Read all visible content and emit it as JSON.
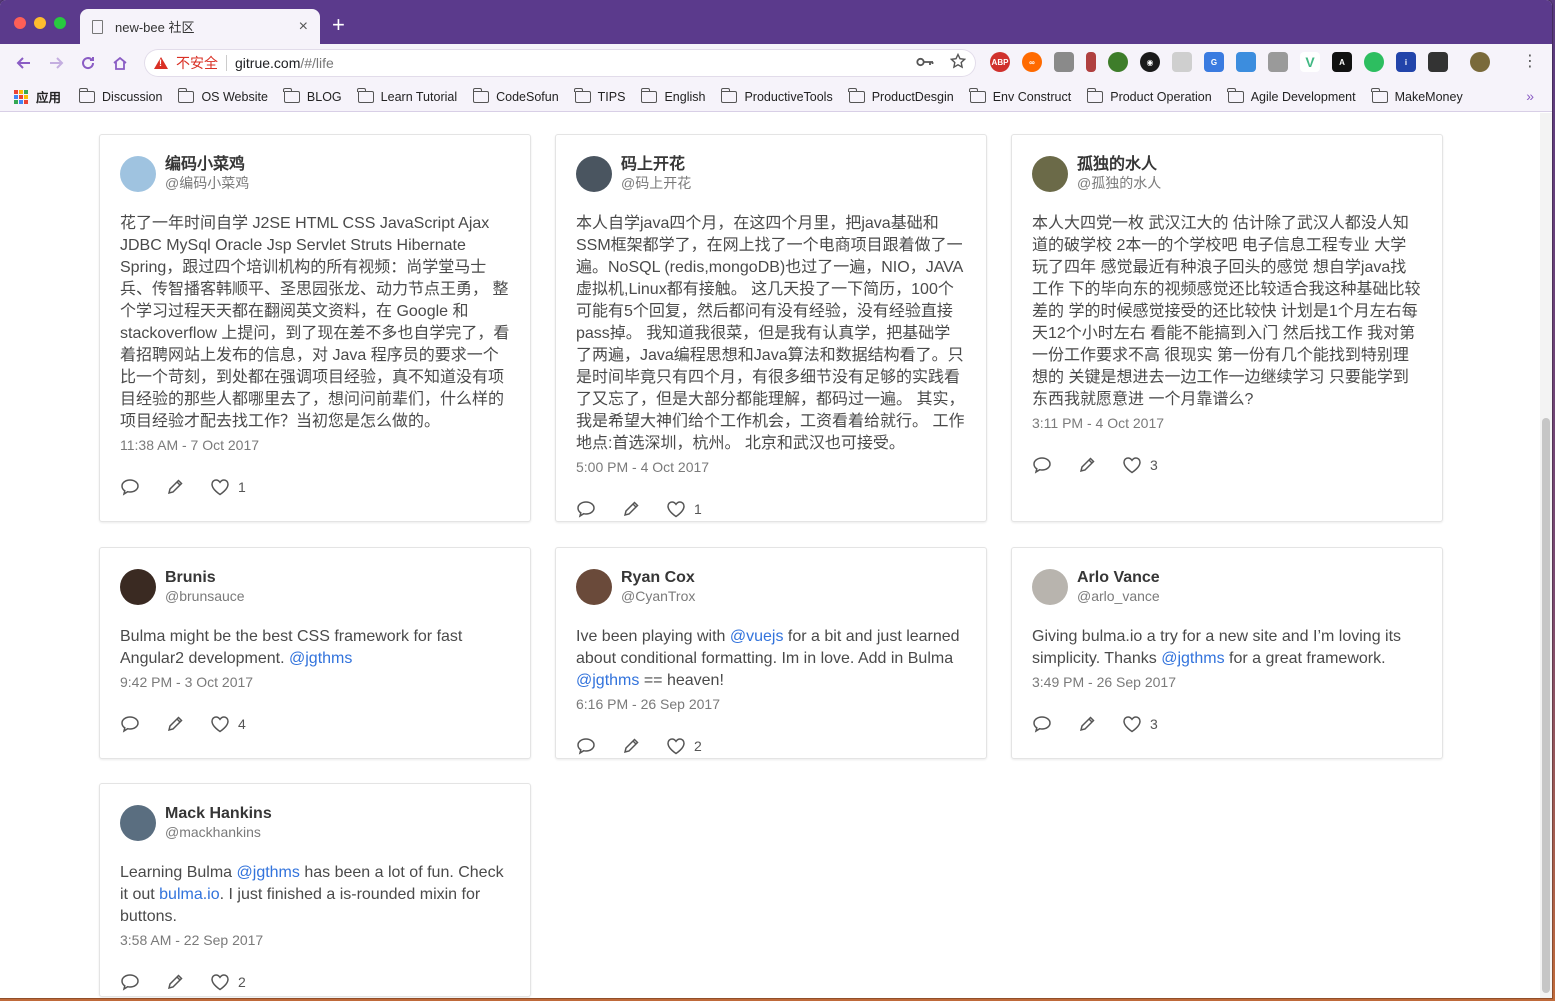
{
  "browser": {
    "tab_title": "new-bee 社区",
    "close_glyph": "×",
    "new_tab_glyph": "+",
    "insecure_label": "不安全",
    "url_host": "gitrue.com",
    "url_path": "/#/life",
    "apps_label": "应用",
    "bookmarks": [
      "Discussion",
      "OS Website",
      "BLOG",
      "Learn Tutorial",
      "CodeSofun",
      "TIPS",
      "English",
      "ProductiveTools",
      "ProductDesgin",
      "Env Construct",
      "Product Operation",
      "Agile Development",
      "MakeMoney"
    ],
    "more_glyph": "»",
    "extensions": [
      "abp-icon",
      "infinity-icon",
      "puzzle-icon",
      "crossed-icon",
      "android-icon",
      "eye-icon",
      "mail-icon",
      "translate-icon",
      "doc-icon",
      "inbox-icon",
      "vue-devtools-icon",
      "antd-icon",
      "evernote-icon",
      "info-icon",
      "code-icon",
      "profile-avatar"
    ]
  },
  "posts": [
    {
      "name": "编码小菜鸡",
      "handle": "@编码小菜鸡",
      "avatar_color": "#9fc3e0",
      "text": "花了一年时间自学 J2SE HTML CSS JavaScript Ajax JDBC MySql Oracle Jsp Servlet Struts Hibernate Spring，跟过四个培训机构的所有视频：尚学堂马士兵、传智播客韩顺平、圣思园张龙、动力节点王勇， 整个学习过程天天都在翻阅英文资料，在 Google 和 stackoverflow 上提问，到了现在差不多也自学完了，看着招聘网站上发布的信息，对 Java 程序员的要求一个比一个苛刻，到处都在强调项目经验，真不知道没有项目经验的那些人都哪里去了，想问问前辈们，什么样的项目经验才配去找工作？当初您是怎么做的。",
      "time": "11:38 AM - 7 Oct 2017",
      "likes": "1"
    },
    {
      "name": "码上开花",
      "handle": "@码上开花",
      "avatar_color": "#4a5560",
      "text": "本人自学java四个月，在这四个月里，把java基础和SSM框架都学了，在网上找了一个电商项目跟着做了一遍。NoSQL (redis,mongoDB)也过了一遍，NIO，JAVA虚拟机,Linux都有接触。 这几天投了一下简历，100个可能有5个回复，然后都问有没有经验，没有经验直接pass掉。 我知道我很菜，但是我有认真学，把基础学了两遍，Java编程思想和Java算法和数据结构看了。只是时间毕竟只有四个月，有很多细节没有足够的实践看了又忘了，但是大部分都能理解，都码过一遍。 其实，我是希望大神们给个工作机会，工资看着给就行。 工作地点:首选深圳，杭州。 北京和武汉也可接受。",
      "time": "5:00 PM - 4 Oct 2017",
      "likes": "1"
    },
    {
      "name": "孤独的水人",
      "handle": "@孤独的水人",
      "avatar_color": "#6b6a48",
      "text": "本人大四党一枚 武汉江大的 估计除了武汉人都没人知道的破学校 2本一的个学校吧 电子信息工程专业 大学玩了四年 感觉最近有种浪子回头的感觉 想自学java找工作 下的毕向东的视频感觉还比较适合我这种基础比较差的 学的时候感觉接受的还比较快 计划是1个月左右每天12个小时左右 看能不能搞到入门 然后找工作 我对第一份工作要求不高 很现实 第一份有几个能找到特别理想的 关键是想进去一边工作一边继续学习 只要能学到东西我就愿意进 一个月靠谱么?",
      "time": "3:11 PM - 4 Oct 2017",
      "likes": "3"
    },
    {
      "name": "Brunis",
      "handle": "@brunsauce",
      "avatar_color": "#3a2a22",
      "text_parts": [
        "Bulma might be the best CSS framework for fast Angular2 development. ",
        "@jgthms",
        ""
      ],
      "time": "9:42 PM - 3 Oct 2017",
      "likes": "4"
    },
    {
      "name": "Ryan Cox",
      "handle": "@CyanTrox",
      "avatar_color": "#6a4a3a",
      "text_parts": [
        "Ive been playing with ",
        "@vuejs",
        " for a bit and just learned about conditional formatting. Im in love. Add in Bulma ",
        "@jgthms",
        " == heaven!"
      ],
      "time": "6:16 PM - 26 Sep 2017",
      "likes": "2"
    },
    {
      "name": "Arlo Vance",
      "handle": "@arlo_vance",
      "avatar_color": "#b8b4ae",
      "text_parts": [
        "Giving bulma.io a try for a new site and I’m loving its simplicity. Thanks ",
        "@jgthms",
        " for a great framework."
      ],
      "time": "3:49 PM - 26 Sep 2017",
      "likes": "3"
    },
    {
      "name": "Mack Hankins",
      "handle": "@mackhankins",
      "avatar_color": "#5a6e80",
      "text_parts": [
        "Learning Bulma ",
        "@jgthms",
        " has been a lot of fun. Check it out ",
        "bulma.io",
        ". I just finished a is-rounded mixin for buttons."
      ],
      "time": "3:58 AM - 22 Sep 2017",
      "likes": "2"
    }
  ]
}
